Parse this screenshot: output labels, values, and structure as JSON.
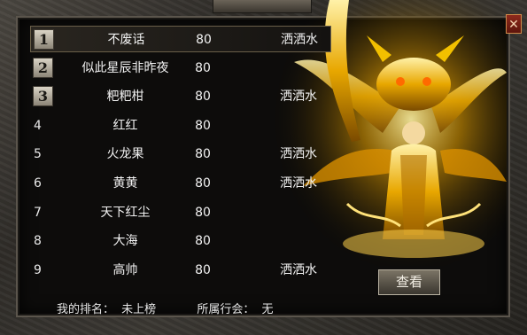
{
  "header": {
    "close": "✕"
  },
  "rankings": [
    {
      "rank": "1",
      "name": "不废话",
      "level": "80",
      "guild": "洒洒水",
      "badge": true,
      "selected": true
    },
    {
      "rank": "2",
      "name": "似此星辰非昨夜",
      "level": "80",
      "guild": "",
      "badge": true,
      "selected": false
    },
    {
      "rank": "3",
      "name": "粑粑柑",
      "level": "80",
      "guild": "洒洒水",
      "badge": true,
      "selected": false
    },
    {
      "rank": "4",
      "name": "红红",
      "level": "80",
      "guild": "",
      "badge": false,
      "selected": false
    },
    {
      "rank": "5",
      "name": "火龙果",
      "level": "80",
      "guild": "洒洒水",
      "badge": false,
      "selected": false
    },
    {
      "rank": "6",
      "name": "黄黄",
      "level": "80",
      "guild": "洒洒水",
      "badge": false,
      "selected": false
    },
    {
      "rank": "7",
      "name": "天下红尘",
      "level": "80",
      "guild": "",
      "badge": false,
      "selected": false
    },
    {
      "rank": "8",
      "name": "大海",
      "level": "80",
      "guild": "",
      "badge": false,
      "selected": false
    },
    {
      "rank": "9",
      "name": "高帅",
      "level": "80",
      "guild": "洒洒水",
      "badge": false,
      "selected": false
    }
  ],
  "footer": {
    "my_rank_label": "我的排名：",
    "my_rank_value": "未上榜",
    "guild_label": "所属行会：",
    "guild_value": "无"
  },
  "view_button": "查看",
  "colors": {
    "accent_gold": "#f5c518",
    "text": "#f2f2f2",
    "close_red": "#8e2a1c"
  }
}
